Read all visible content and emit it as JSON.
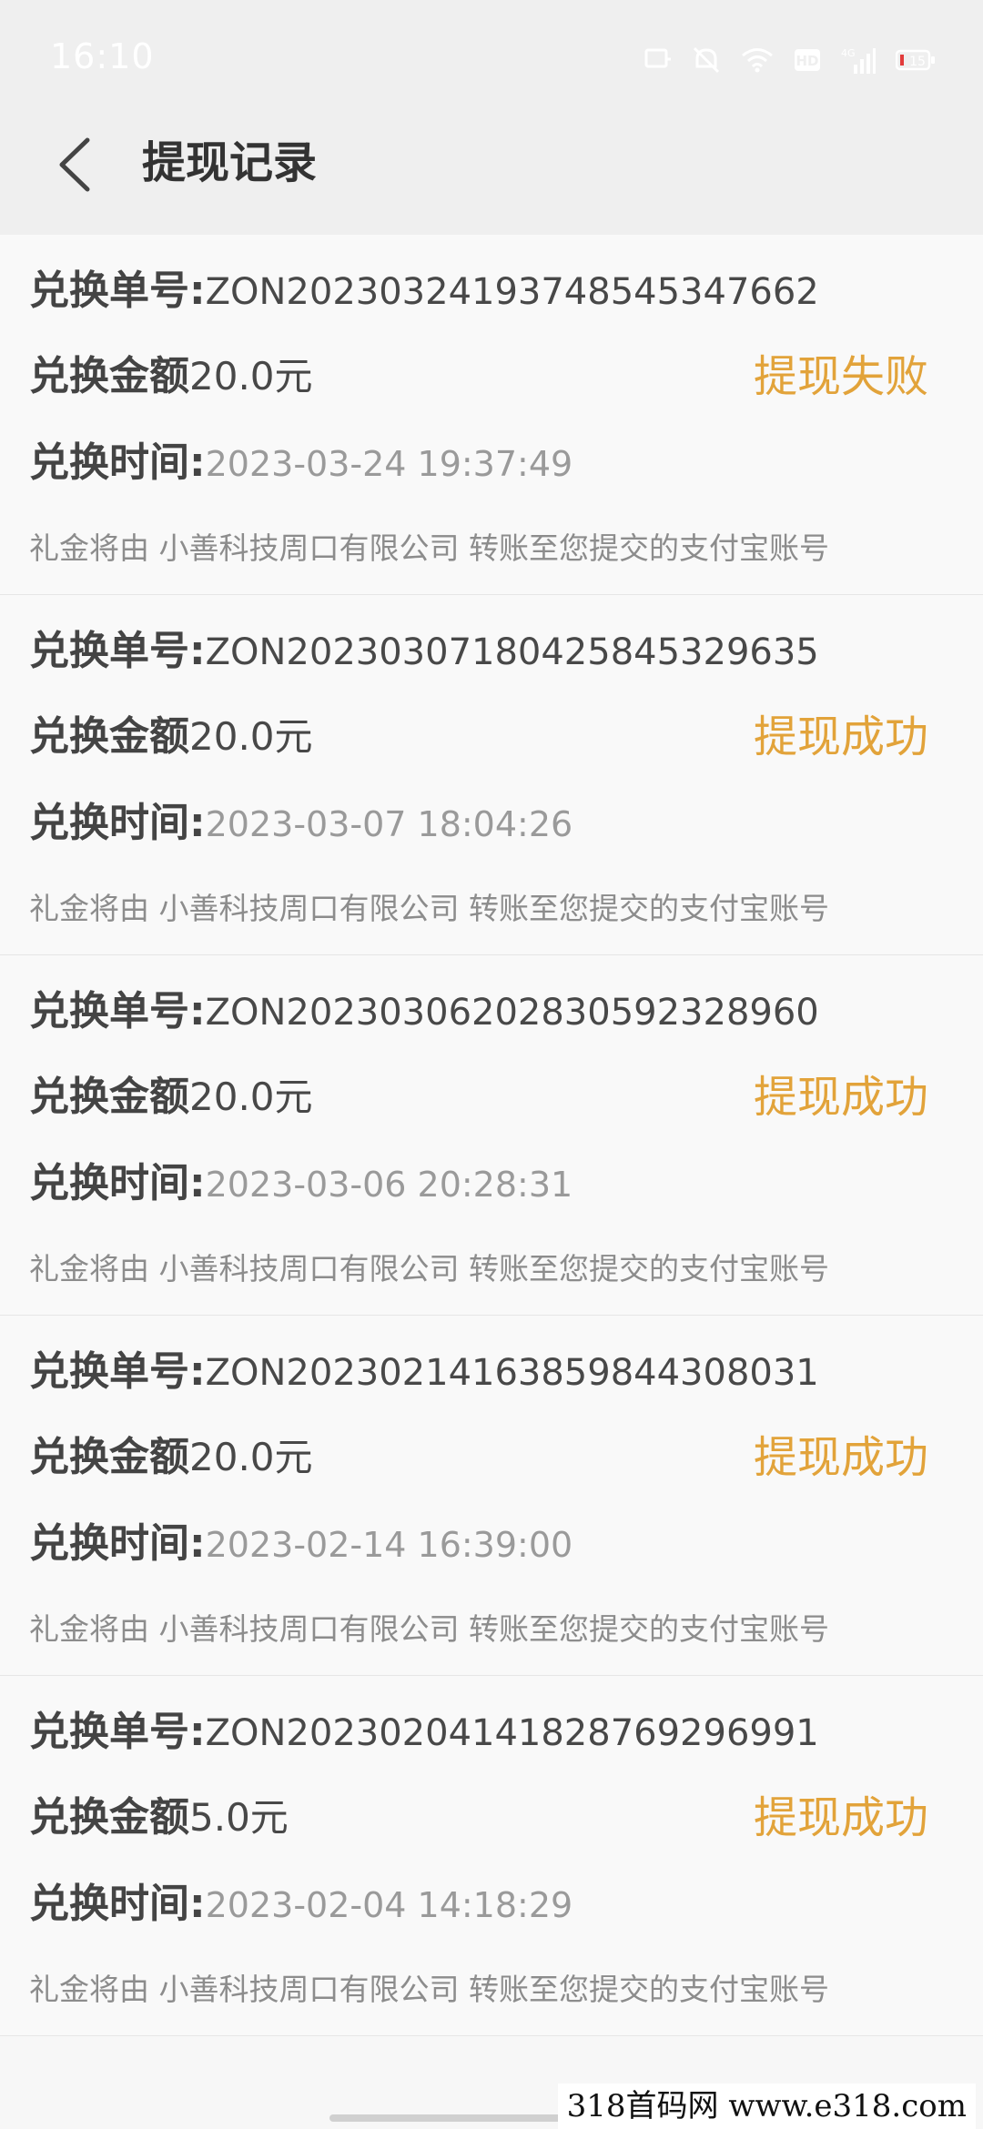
{
  "status_bar": {
    "time": "16:10",
    "battery": "15",
    "icons": [
      "nfc-icon",
      "mute-icon",
      "wifi-icon",
      "hd-icon",
      "signal-icon",
      "battery-icon"
    ],
    "network_label": "4G"
  },
  "header": {
    "title": "提现记录",
    "back_icon": "chevron-left-icon"
  },
  "labels": {
    "order_no": "兑换单号:",
    "amount": "兑换金额",
    "time": "兑换时间:"
  },
  "records": [
    {
      "order_no": "ZON20230324193748545347662",
      "amount": "20.0元",
      "time": "2023-03-24 19:37:49",
      "status": "提现失败",
      "note": "礼金将由 小善科技周口有限公司 转账至您提交的支付宝账号"
    },
    {
      "order_no": "ZON20230307180425845329635",
      "amount": "20.0元",
      "time": "2023-03-07 18:04:26",
      "status": "提现成功",
      "note": "礼金将由 小善科技周口有限公司 转账至您提交的支付宝账号"
    },
    {
      "order_no": "ZON20230306202830592328960",
      "amount": "20.0元",
      "time": "2023-03-06 20:28:31",
      "status": "提现成功",
      "note": "礼金将由 小善科技周口有限公司 转账至您提交的支付宝账号"
    },
    {
      "order_no": "ZON20230214163859844308031",
      "amount": "20.0元",
      "time": "2023-02-14 16:39:00",
      "status": "提现成功",
      "note": "礼金将由 小善科技周口有限公司 转账至您提交的支付宝账号"
    },
    {
      "order_no": "ZON20230204141828769296991",
      "amount": "5.0元",
      "time": "2023-02-04 14:18:29",
      "status": "提现成功",
      "note": "礼金将由 小善科技周口有限公司 转账至您提交的支付宝账号"
    }
  ],
  "colors": {
    "status": "#e2a33a",
    "background": "#f7f7f7",
    "header_bg": "#efefef"
  },
  "watermark": "318首码网 www.e318.com"
}
